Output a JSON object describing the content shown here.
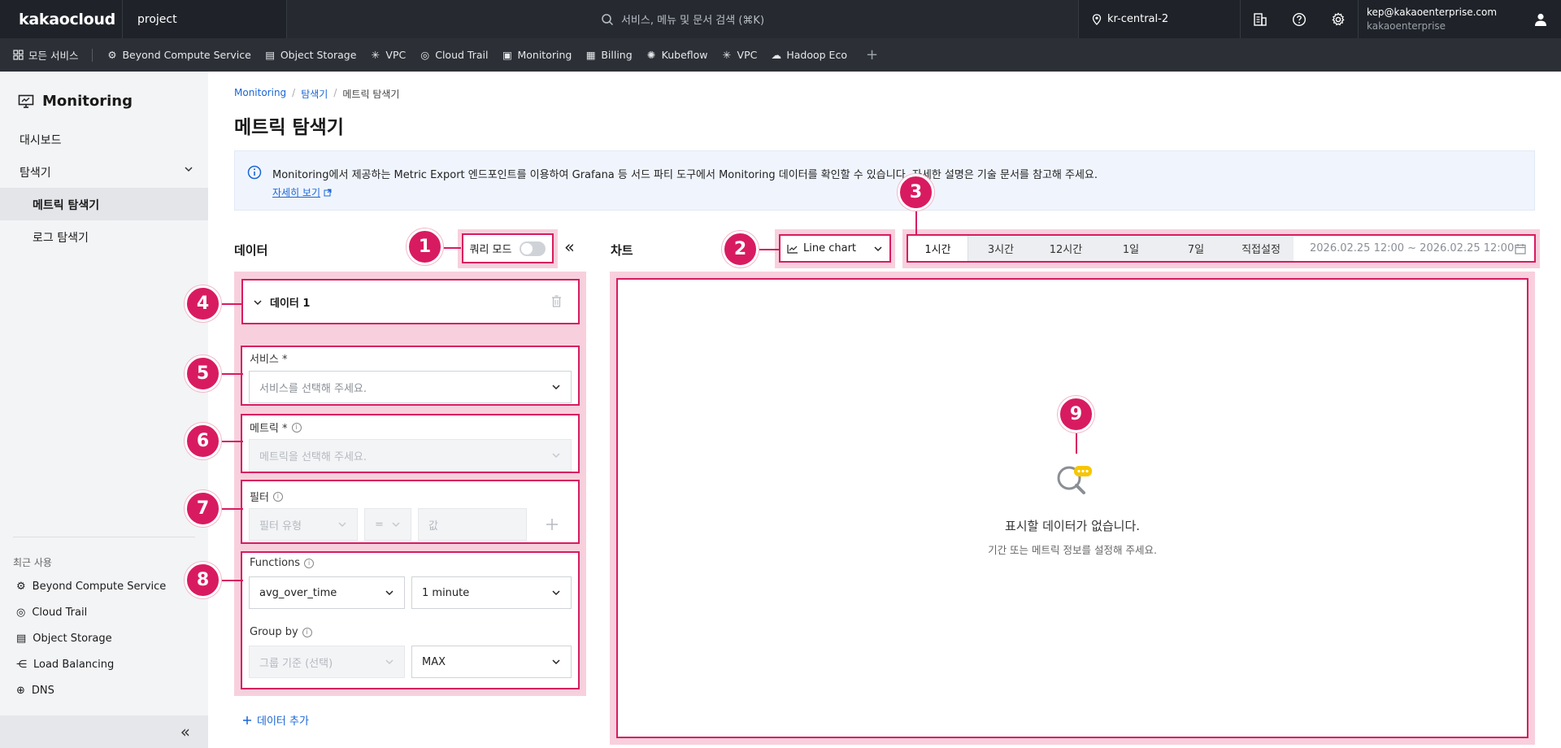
{
  "topbar": {
    "logo": "kakaocloud",
    "project": "project",
    "search_placeholder": "서비스, 메뉴 및 문서 검색 (⌘K)",
    "region": "kr-central-2",
    "account_email": "kep@kakaoenterprise.com",
    "account_org": "kakaoenterprise"
  },
  "servicebar": {
    "all_services": "모든 서비스",
    "items": [
      "Beyond Compute Service",
      "Object Storage",
      "VPC",
      "Cloud Trail",
      "Monitoring",
      "Billing",
      "Kubeflow",
      "VPC",
      "Hadoop Eco"
    ],
    "add": "+"
  },
  "sidebar": {
    "title": "Monitoring",
    "dashboard": "대시보드",
    "explorer": "탐색기",
    "metric_explorer": "메트릭 탐색기",
    "log_explorer": "로그 탐색기",
    "recent_title": "최근 사용",
    "recent": [
      "Beyond Compute Service",
      "Cloud Trail",
      "Object Storage",
      "Load Balancing",
      "DNS"
    ]
  },
  "breadcrumb": [
    "Monitoring",
    "/",
    "탐색기",
    "/",
    "메트릭 탐색기"
  ],
  "page_title": "메트릭 탐색기",
  "info": {
    "text": "Monitoring에서 제공하는 Metric Export 엔드포인트를 이용하여 Grafana 등 서드 파티 도구에서 Monitoring 데이터를 확인할 수 있습니다. 자세한 설명은 기술 문서를 참고해 주세요.",
    "more": "자세히 보기"
  },
  "data_section": {
    "title": "데이터",
    "query_mode": "쿼리 모드",
    "collapse": "«",
    "data_item": "데이터 1",
    "service_label": "서비스 *",
    "service_placeholder": "서비스를 선택해 주세요.",
    "metric_label": "메트릭 *",
    "metric_placeholder": "메트릭을 선택해 주세요.",
    "filter_label": "필터",
    "filter_type": "필터 유형",
    "filter_op": "=",
    "filter_value": "값",
    "functions_label": "Functions",
    "function_value": "avg_over_time",
    "interval_value": "1 minute",
    "groupby_label": "Group by",
    "groupby_placeholder": "그룹 기준 (선택)",
    "agg_value": "MAX",
    "add_data": "데이터 추가"
  },
  "chart_section": {
    "title": "차트",
    "chart_type": "Line chart",
    "ranges": [
      "1시간",
      "3시간",
      "12시간",
      "1일",
      "7일",
      "직접설정"
    ],
    "active_range": "1시간",
    "date_range": "2026.02.25 12:00 ~ 2026.02.25 12:00",
    "empty_title": "표시할 데이터가 없습니다.",
    "empty_sub": "기간 또는 메트릭 정보를 설정해 주세요."
  },
  "markers": [
    "1",
    "2",
    "3",
    "4",
    "5",
    "6",
    "7",
    "8",
    "9"
  ],
  "colors": {
    "accent": "#d81b60",
    "highlight": "#f8d0dd",
    "link": "#1a66d6",
    "topbar": "#1f2329"
  }
}
